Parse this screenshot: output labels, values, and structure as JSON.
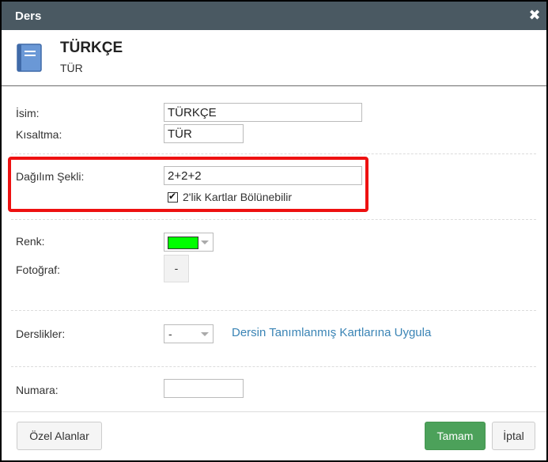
{
  "dialog": {
    "title": "Ders",
    "close_symbol": "✖"
  },
  "header": {
    "name": "TÜRKÇE",
    "short": "TÜR"
  },
  "fields": {
    "isim_label": "İsim:",
    "isim_value": "TÜRKÇE",
    "kisaltma_label": "Kısaltma:",
    "kisaltma_value": "TÜR",
    "dagilim_label": "Dağılım Şekli:",
    "dagilim_value": "2+2+2",
    "checkbox_label": "2'lik Kartlar Bölünebilir",
    "checkbox_checked": true,
    "renk_label": "Renk:",
    "renk_color": "#00ff00",
    "fotograf_label": "Fotoğraf:",
    "fotograf_button": "-",
    "derslikler_label": "Derslikler:",
    "derslikler_value": "-",
    "apply_link": "Dersin Tanımlanmış Kartlarına Uygula",
    "numara_label": "Numara:",
    "numara_value": ""
  },
  "footer": {
    "custom_fields": "Özel Alanlar",
    "ok": "Tamam",
    "cancel": "İptal"
  },
  "colors": {
    "titlebar": "#4a5962",
    "highlight": "#ee1111",
    "primary": "#4ca15a",
    "link": "#3a84b5"
  }
}
